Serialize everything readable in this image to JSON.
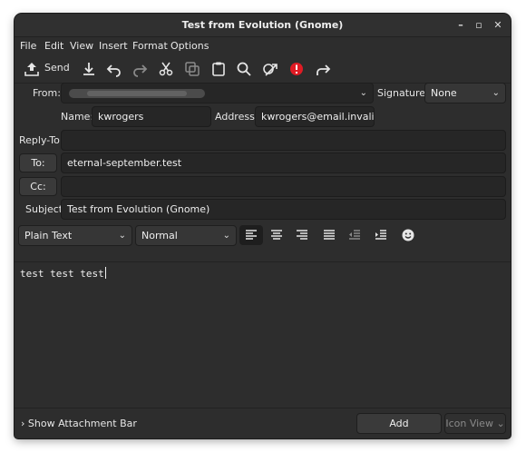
{
  "window": {
    "title": "Test from Evolution (Gnome)"
  },
  "wm_buttons": {
    "minimize": "–",
    "maximize": "▫",
    "close": "✕"
  },
  "menu": [
    "File",
    "Edit",
    "View",
    "Insert",
    "Format",
    "Options"
  ],
  "toolbar": {
    "send_label": "Send"
  },
  "header": {
    "from_label": "From:",
    "signature_label": "Signature:",
    "signature_value": "None",
    "name_label": "Name:",
    "name_value": "kwrogers",
    "address_label": "Address:",
    "address_value": "kwrogers@email.invalid",
    "reply_to_label": "Reply-To:",
    "reply_to_value": "",
    "to_button": "To:",
    "to_value": "eternal-september.test",
    "cc_button": "Cc:",
    "cc_value": "",
    "subject_label": "Subject:",
    "subject_value": "Test from Evolution (Gnome)"
  },
  "format_bar": {
    "mode": "Plain Text",
    "paragraph_style": "Normal"
  },
  "body_text": "test test test",
  "bottom": {
    "show_attachment_bar": "Show Attachment Bar",
    "add_attachment": "Add Attachment…",
    "icon_view": "Icon View"
  },
  "colors": {
    "window_bg": "#2d2d2d",
    "field_bg": "#262626",
    "accent_red": "#e01b24"
  }
}
